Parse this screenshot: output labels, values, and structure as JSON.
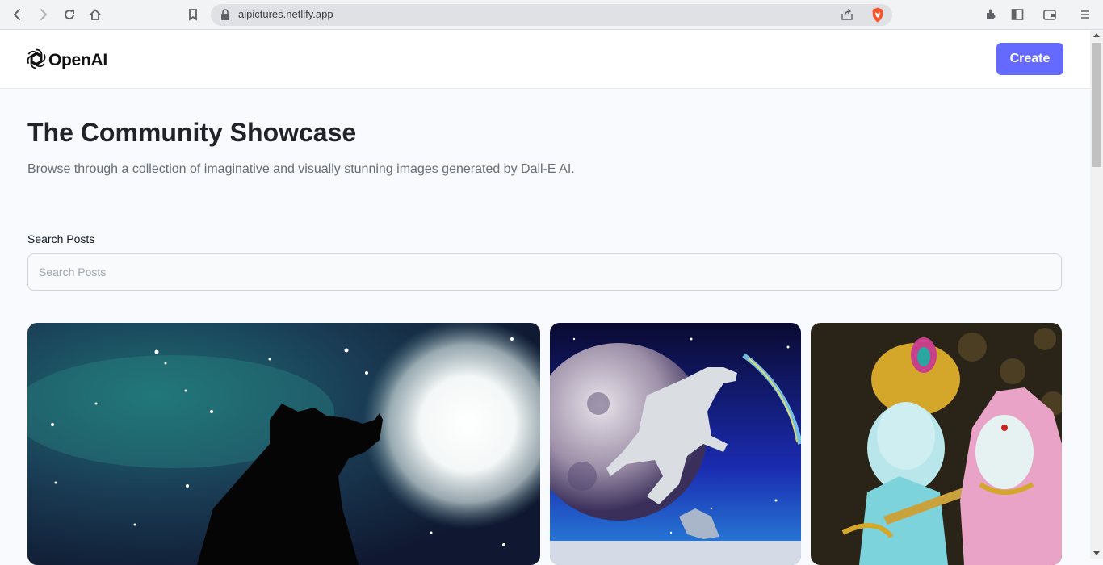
{
  "browser": {
    "url": "aipictures.netlify.app",
    "icons": [
      "back-icon",
      "forward-icon",
      "reload-icon",
      "home-icon",
      "bookmark-icon",
      "lock-icon",
      "share-icon",
      "brave-shield-icon",
      "extensions-icon",
      "sidebar-icon",
      "wallet-icon",
      "menu-icon"
    ]
  },
  "header": {
    "logo_text": "OpenAI",
    "create_label": "Create"
  },
  "main": {
    "title": "The Community Showcase",
    "subtitle": "Browse through a collection of imaginative and visually stunning images generated by Dall-E AI.",
    "search_label": "Search Posts",
    "search_placeholder": "Search Posts",
    "search_value": ""
  },
  "posts": [
    {
      "name": "wolf-howling-at-moon-image"
    },
    {
      "name": "dog-jumping-over-moon-image"
    },
    {
      "name": "krishna-radha-statue-image"
    }
  ],
  "colors": {
    "accent": "#6469ff",
    "title": "#222328",
    "subtitle": "#666e75",
    "background": "#f9fafe"
  }
}
